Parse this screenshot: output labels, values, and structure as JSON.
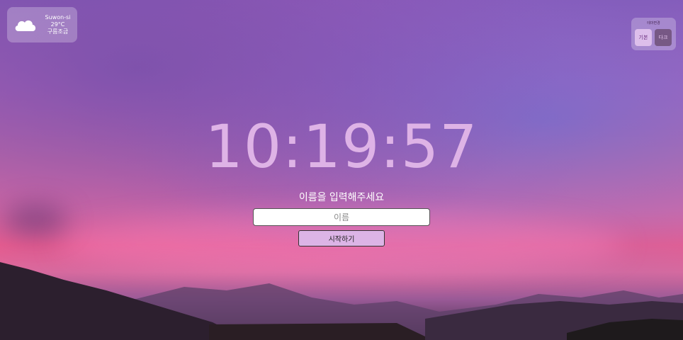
{
  "weather": {
    "city": "Suwon-si",
    "temperature": "29°C",
    "condition": "구름조금",
    "icon": "cloud-icon"
  },
  "theme": {
    "title": "테마변경",
    "light_label": "기본",
    "dark_label": "다크"
  },
  "clock": {
    "time": "10:19:57"
  },
  "greeting": {
    "prompt": "이름을 입력해주세요",
    "input_placeholder": "이름",
    "input_value": "",
    "start_label": "시작하기"
  },
  "colors": {
    "clock_text": "#deb3e6",
    "button_bg": "#dcb4e6",
    "widget_bg": "rgba(255,255,255,0.25)"
  }
}
